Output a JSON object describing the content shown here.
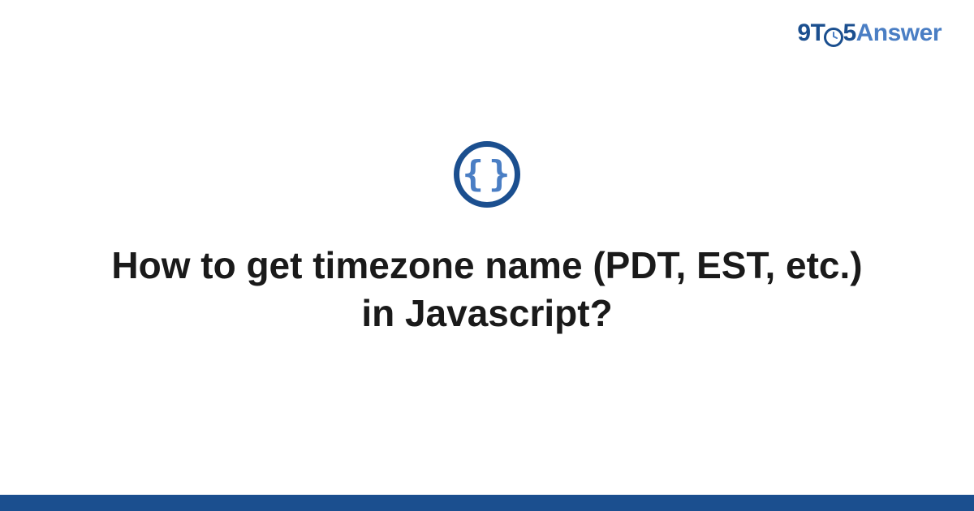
{
  "brand": {
    "part1": "9T",
    "clock_glyph": "⦿",
    "part2": "5",
    "part3": "Answer"
  },
  "category_icon": {
    "name": "code-braces",
    "glyph": "{}"
  },
  "title": "How to get timezone name (PDT, EST, etc.) in Javascript?",
  "colors": {
    "primary": "#1b4f8f",
    "secondary": "#4a7ec4"
  }
}
